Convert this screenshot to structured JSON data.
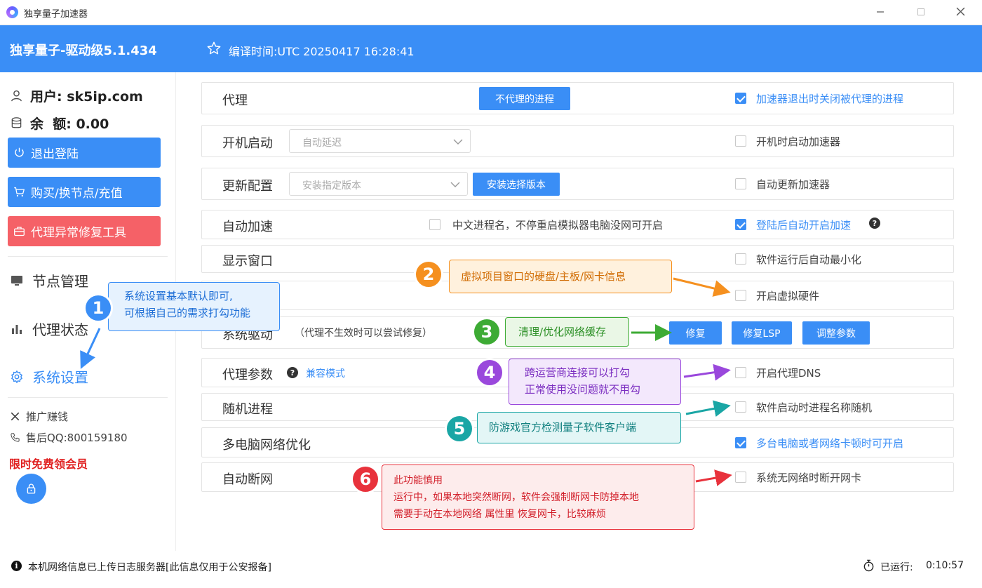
{
  "window": {
    "title": "独享量子加速器"
  },
  "header": {
    "version": "独享量子-驱动级5.1.434",
    "compile_time": "编译时间:UTC 20250417 16:28:41"
  },
  "sidebar": {
    "user": "用户: sk5ip.com",
    "balance": "余  额: 0.00",
    "logout": "退出登陆",
    "buy": "购买/换节点/充值",
    "repair_tool": "代理异常修复工具",
    "nav": {
      "nodes": "节点管理",
      "proxy_status": "代理状态",
      "settings": "系统设置"
    },
    "promote": "推广赚钱",
    "support_qq": "售后QQ:800159180",
    "free_vip": "限时免费领会员"
  },
  "rows": {
    "proxy": {
      "label": "代理",
      "button": "不代理的进程",
      "checkbox": "加速器退出时关闭被代理的进程",
      "checked": true
    },
    "startup": {
      "label": "开机启动",
      "select": "自动延迟",
      "checkbox": "开机时启动加速器",
      "checked": false
    },
    "update": {
      "label": "更新配置",
      "select": "安装指定版本",
      "button": "安装选择版本",
      "checkbox": "自动更新加速器",
      "checked": false
    },
    "auto_accel": {
      "label": "自动加速",
      "chinese_proc": "中文进程名，不停重启模拟器电脑没网可开启",
      "checkbox": "登陆后自动开启加速",
      "checked": true,
      "help": "?"
    },
    "display": {
      "label": "显示窗口",
      "checkbox": "软件运行后自动最小化",
      "checked": false
    },
    "virtual_hw": {
      "checkbox": "开启虚拟硬件",
      "checked": false
    },
    "driver": {
      "label": "系统驱动",
      "note": "（代理不生效时可以尝试修复）",
      "repair": "修复",
      "repair_lsp": "修复LSP",
      "adjust": "调整参数"
    },
    "proxy_params": {
      "label": "代理参数",
      "help": "?",
      "compat": "兼容模式",
      "checkbox": "开启代理DNS",
      "checked": false
    },
    "random_proc": {
      "label": "随机进程",
      "checkbox": "软件启动时进程名称随机",
      "checked": false
    },
    "multi_pc": {
      "label": "多电脑网络优化",
      "checkbox": "多台电脑或者网络卡顿时可开启",
      "checked": true
    },
    "auto_disconnect": {
      "label": "自动断网",
      "checkbox": "系统无网络时断开网卡",
      "checked": false
    }
  },
  "annotations": {
    "a1": {
      "num": "1",
      "line1": "系统设置基本默认即可,",
      "line2": "可根据自己的需求打勾功能"
    },
    "a2": {
      "num": "2",
      "text": "虚拟项目窗口的硬盘/主板/网卡信息"
    },
    "a3": {
      "num": "3",
      "text": "清理/优化网络缓存"
    },
    "a4": {
      "num": "4",
      "line1": "跨运营商连接可以打勾",
      "line2": "正常使用没问题就不用勾"
    },
    "a5": {
      "num": "5",
      "text": "防游戏官方检测量子软件客户端"
    },
    "a6": {
      "num": "6",
      "line1": "此功能慎用",
      "line2": "运行中，如果本地突然断网，软件会强制断网卡防掉本地",
      "line3": "需要手动在本地网络 属性里 恢复网卡，比较麻烦"
    }
  },
  "status": {
    "info": "i",
    "message": "本机网络信息已上传日志服务器[此信息仅用于公安报备]",
    "runtime_label": "已运行:",
    "runtime_value": "0:10:57"
  },
  "colors": {
    "accent": "#3a8ef6",
    "danger": "#f56167",
    "orange": "#f5901f",
    "green": "#3dab34",
    "purple": "#9a48dc",
    "teal": "#1aa6a5",
    "red": "#e8323c"
  }
}
